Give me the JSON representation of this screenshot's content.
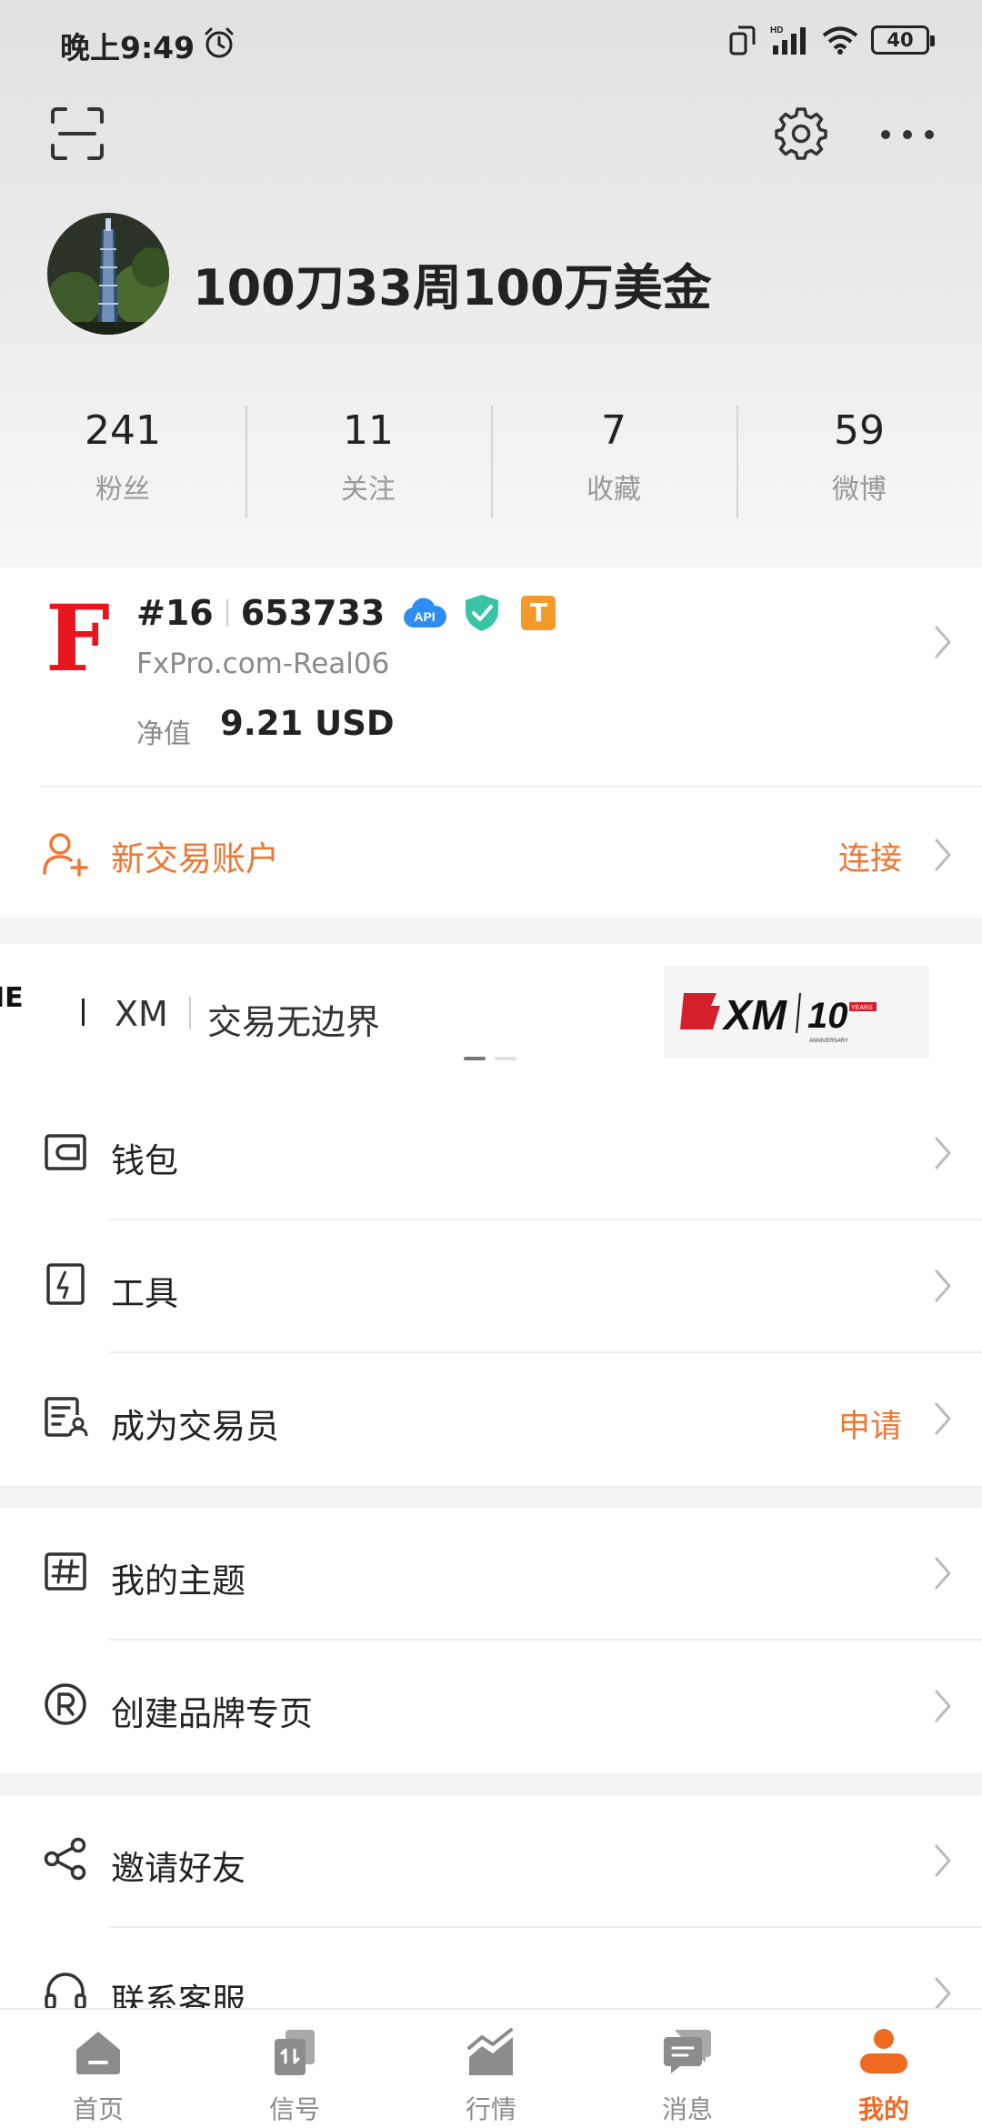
{
  "status_bar": {
    "time": "晚上9:49",
    "network_badge": "HD",
    "battery": "40"
  },
  "profile": {
    "username": "100刀33周100万美金",
    "stats": [
      {
        "value": "241",
        "label": "粉丝"
      },
      {
        "value": "11",
        "label": "关注"
      },
      {
        "value": "7",
        "label": "收藏"
      },
      {
        "value": "59",
        "label": "微博"
      }
    ]
  },
  "account": {
    "broker_logo": "F",
    "rank": "#16",
    "number": "653733",
    "api_badge": "API",
    "type_badge": "T",
    "server": "FxPro.com-Real06",
    "equity_label": "净值",
    "equity_value": "9.21 USD",
    "new_account_label": "新交易账户",
    "connect_label": "连接"
  },
  "banner": {
    "prev_fragment": "IE",
    "brand": "XM",
    "slogan": "交易无边界",
    "logo_text": "XM",
    "logo_years": "YEARS",
    "logo_anniversary": "ANNIVERSARY"
  },
  "menu": {
    "group1": [
      {
        "label": "钱包",
        "extra": "",
        "icon": "wallet-icon"
      },
      {
        "label": "工具",
        "extra": "",
        "icon": "tools-icon"
      },
      {
        "label": "成为交易员",
        "extra": "申请",
        "icon": "trader-card-icon"
      }
    ],
    "group2": [
      {
        "label": "我的主题",
        "extra": "",
        "icon": "hashtag-icon"
      },
      {
        "label": "创建品牌专页",
        "extra": "",
        "icon": "registered-icon"
      }
    ],
    "group3": [
      {
        "label": "邀请好友",
        "extra": "",
        "icon": "share-icon"
      },
      {
        "label": "联系客服",
        "extra": "",
        "icon": "headset-icon"
      }
    ]
  },
  "tabbar": [
    {
      "label": "首页",
      "icon": "home-icon",
      "active": false
    },
    {
      "label": "信号",
      "icon": "signal-icon",
      "active": false
    },
    {
      "label": "行情",
      "icon": "market-icon",
      "active": false
    },
    {
      "label": "消息",
      "icon": "message-icon",
      "active": false
    },
    {
      "label": "我的",
      "icon": "profile-icon",
      "active": true
    }
  ],
  "colors": {
    "accent": "#ee7733",
    "broker_red": "#e8151d",
    "api_blue": "#2f8cf0",
    "verified_teal": "#39c4a5",
    "badge_orange": "#f39a2b"
  }
}
